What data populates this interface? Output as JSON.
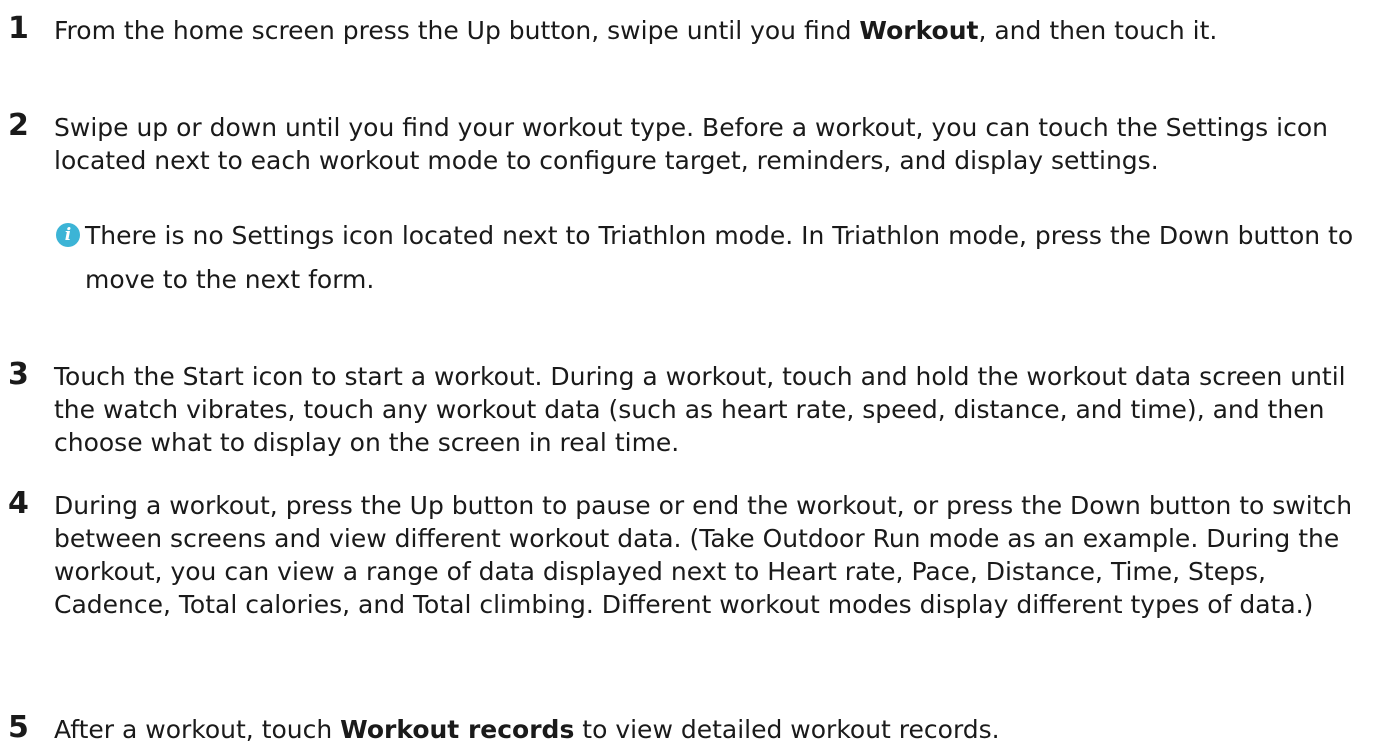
{
  "steps": [
    {
      "number": "1",
      "pre": "From the home screen press the Up button, swipe until you find ",
      "bold": "Workout",
      "post": ", and then touch it."
    },
    {
      "number": "2",
      "text": "Swipe up or down until you find your workout type. Before a workout, you can touch the Settings icon located next to each workout mode to configure target, reminders, and display settings.",
      "note": {
        "icon": "info-icon",
        "text": "There is no Settings icon located next to Triathlon mode. In Triathlon mode, press the Down button to move to the next form."
      }
    },
    {
      "number": "3",
      "text": "Touch the Start icon to start a workout. During a workout, touch and hold the workout data screen until the watch vibrates, touch any workout data (such as heart rate, speed, distance, and time), and then choose what to display on the screen in real time."
    },
    {
      "number": "4",
      "text": "During a workout, press the Up button to pause or end the workout, or press the Down button to switch between screens and view different workout data. (Take Outdoor Run mode as an example. During the workout, you can view a range of data displayed next to Heart rate, Pace, Distance, Time, Steps, Cadence, Total calories, and Total climbing. Different workout modes display different types of data.)"
    },
    {
      "number": "5",
      "pre": "After a workout, touch ",
      "bold": "Workout records",
      "post": " to view detailed workout records."
    }
  ],
  "colors": {
    "note_icon": "#3cb4d6",
    "text": "#1a1a1a"
  }
}
